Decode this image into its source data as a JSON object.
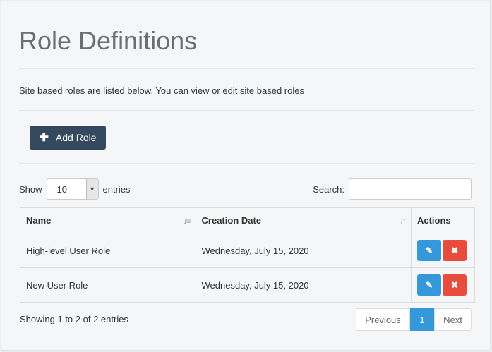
{
  "page": {
    "title": "Role Definitions",
    "description": "Site based roles are listed below. You can view or edit site based roles"
  },
  "toolbar": {
    "add_role_label": "Add Role"
  },
  "length_control": {
    "show_label": "Show",
    "selected": "10",
    "entries_label": "entries"
  },
  "search": {
    "label": "Search:",
    "value": ""
  },
  "table": {
    "headers": {
      "name": "Name",
      "creation_date": "Creation Date",
      "actions": "Actions"
    },
    "rows": [
      {
        "name": "High-level User Role",
        "creation_date": "Wednesday, July 15, 2020"
      },
      {
        "name": "New User Role",
        "creation_date": "Wednesday, July 15, 2020"
      }
    ]
  },
  "footer": {
    "info": "Showing 1 to 2 of 2 entries",
    "previous": "Previous",
    "current_page": "1",
    "next": "Next"
  },
  "colors": {
    "primary": "#3498db",
    "danger": "#e74c3c",
    "dark": "#34495e"
  },
  "icons": {
    "add": "plus-icon",
    "edit": "edit-icon",
    "delete": "close-icon",
    "sort_active": "sort-alpha-icon",
    "sort": "sort-icon",
    "select_arrow": "chevron-down-icon"
  }
}
